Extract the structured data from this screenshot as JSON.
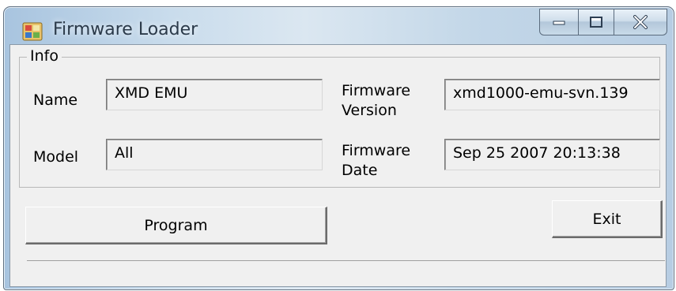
{
  "window": {
    "title": "Firmware Loader",
    "icon": "firmware-loader-app-icon",
    "controls": {
      "minimize": "minimize-icon",
      "maximize": "maximize-icon",
      "close": "close-icon"
    }
  },
  "info_group": {
    "legend": "Info",
    "name": {
      "label": "Name",
      "value": "XMD EMU"
    },
    "model": {
      "label": "Model",
      "value": "All"
    },
    "firmware_version": {
      "label_line1": "Firmware",
      "label_line2": "Version",
      "value": "xmd1000-emu-svn.139"
    },
    "firmware_date": {
      "label_line1": "Firmware",
      "label_line2": "Date",
      "value": "Sep 25 2007 20:13:38"
    }
  },
  "buttons": {
    "program": "Program",
    "exit": "Exit"
  },
  "status": {
    "text": ""
  }
}
